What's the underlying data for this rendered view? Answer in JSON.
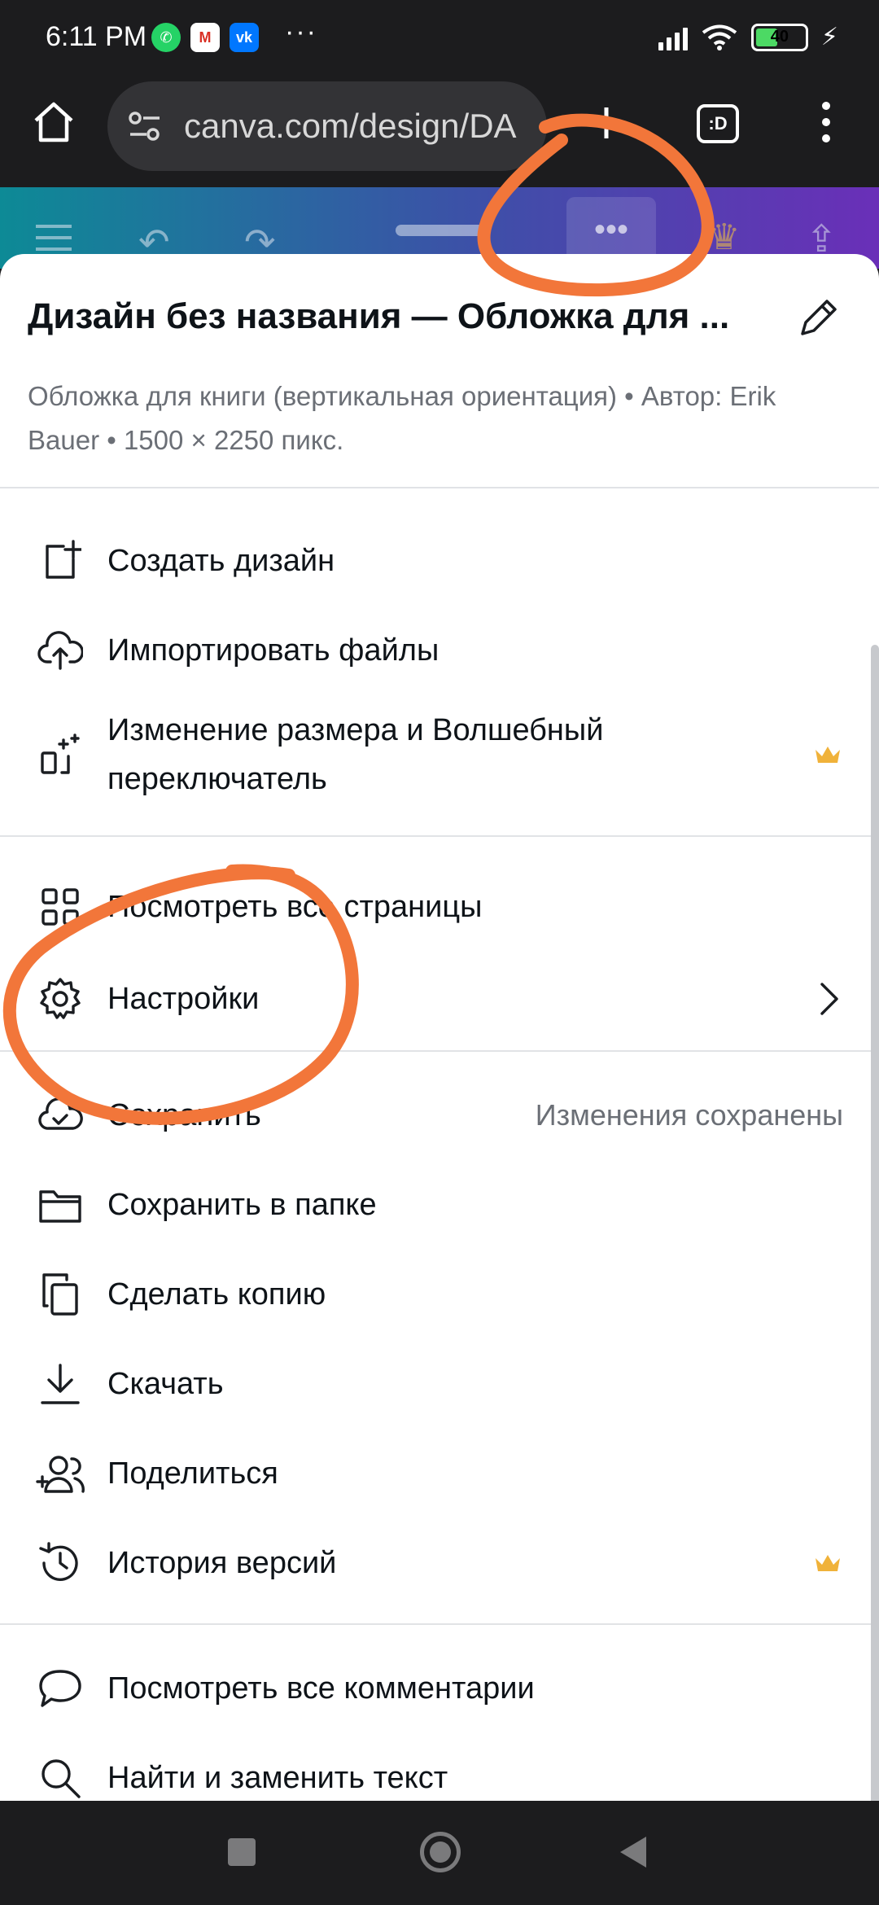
{
  "status_bar": {
    "time": "6:11 PM",
    "notification_icons": [
      "whatsapp-icon",
      "gmail-icon",
      "vk-icon"
    ],
    "more": "···",
    "battery_level": "40"
  },
  "browser": {
    "url": "canva.com/design/DA",
    "tabs_label": ":D"
  },
  "sheet": {
    "title": "Дизайн без названия — Обложка для ...",
    "meta": "Обложка для книги (вертикальная ориентация) • Автор: Erik Bauer • 1500 × 2250 пикс.",
    "items": [
      {
        "icon": "add-design-icon",
        "label": "Создать дизайн"
      },
      {
        "icon": "upload-cloud-icon",
        "label": "Импортировать файлы"
      },
      {
        "icon": "magic-resize-icon",
        "label": "Изменение размера и Волшебный переключатель",
        "premium": true
      },
      {
        "icon": "grid-icon",
        "label": "Посмотреть все страницы"
      },
      {
        "icon": "gear-icon",
        "label": "Настройки",
        "has_submenu": true
      },
      {
        "icon": "cloud-check-icon",
        "label": "Сохранить",
        "status": "Изменения сохранены"
      },
      {
        "icon": "folder-icon",
        "label": "Сохранить в папке"
      },
      {
        "icon": "copy-icon",
        "label": "Сделать копию"
      },
      {
        "icon": "download-icon",
        "label": "Скачать"
      },
      {
        "icon": "share-people-icon",
        "label": "Поделиться"
      },
      {
        "icon": "history-icon",
        "label": "История версий",
        "premium": true
      },
      {
        "icon": "comment-icon",
        "label": "Посмотреть все комментарии"
      },
      {
        "icon": "search-icon",
        "label": "Найти и заменить текст"
      }
    ]
  },
  "colors": {
    "annotation": "#f2763a",
    "premium_crown": "#f0b23a",
    "toolbar_gradient": [
      "#0d8a96",
      "#6a2fb8"
    ]
  }
}
